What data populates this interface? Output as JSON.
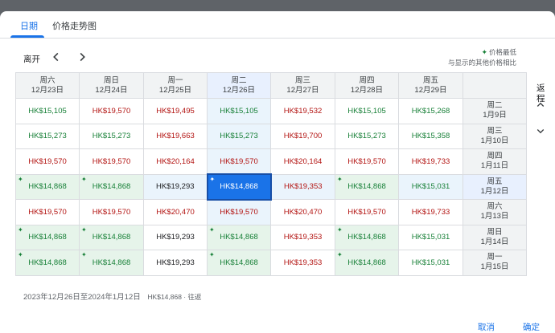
{
  "tabs": [
    {
      "label": "日期",
      "active": true
    },
    {
      "label": "价格走势图",
      "active": false
    }
  ],
  "toolbar": {
    "depart_label": "离开",
    "legend_lowest": "价格最低",
    "legend_note": "与显示的其他价格相比"
  },
  "return_label": "返程",
  "columns": [
    {
      "weekday": "周六",
      "date": "12月23日"
    },
    {
      "weekday": "周日",
      "date": "12月24日"
    },
    {
      "weekday": "周一",
      "date": "12月25日"
    },
    {
      "weekday": "周二",
      "date": "12月26日"
    },
    {
      "weekday": "周三",
      "date": "12月27日"
    },
    {
      "weekday": "周四",
      "date": "12月28日"
    },
    {
      "weekday": "周五",
      "date": "12月29日"
    }
  ],
  "rows": [
    {
      "weekday": "周二",
      "date": "1月9日",
      "cells": [
        {
          "p": "HK$15,105",
          "c": "green"
        },
        {
          "p": "HK$19,570",
          "c": "red"
        },
        {
          "p": "HK$19,495",
          "c": "red"
        },
        {
          "p": "HK$15,105",
          "c": "green"
        },
        {
          "p": "HK$19,532",
          "c": "red"
        },
        {
          "p": "HK$15,105",
          "c": "green"
        },
        {
          "p": "HK$15,268",
          "c": "green"
        }
      ]
    },
    {
      "weekday": "周三",
      "date": "1月10日",
      "cells": [
        {
          "p": "HK$15,273",
          "c": "green"
        },
        {
          "p": "HK$15,273",
          "c": "green"
        },
        {
          "p": "HK$19,663",
          "c": "red"
        },
        {
          "p": "HK$15,273",
          "c": "green"
        },
        {
          "p": "HK$19,700",
          "c": "red"
        },
        {
          "p": "HK$15,273",
          "c": "green"
        },
        {
          "p": "HK$15,358",
          "c": "green"
        }
      ]
    },
    {
      "weekday": "周四",
      "date": "1月11日",
      "cells": [
        {
          "p": "HK$19,570",
          "c": "red"
        },
        {
          "p": "HK$19,570",
          "c": "red"
        },
        {
          "p": "HK$20,164",
          "c": "red"
        },
        {
          "p": "HK$19,570",
          "c": "red"
        },
        {
          "p": "HK$20,164",
          "c": "red"
        },
        {
          "p": "HK$19,570",
          "c": "red"
        },
        {
          "p": "HK$19,733",
          "c": "red"
        }
      ]
    },
    {
      "weekday": "周五",
      "date": "1月12日",
      "cells": [
        {
          "p": "HK$14,868",
          "c": "green",
          "low": true
        },
        {
          "p": "HK$14,868",
          "c": "green",
          "low": true
        },
        {
          "p": "HK$19,293",
          "c": "black"
        },
        {
          "p": "HK$14,868",
          "c": "selected"
        },
        {
          "p": "HK$19,353",
          "c": "red"
        },
        {
          "p": "HK$14,868",
          "c": "green",
          "low": true
        },
        {
          "p": "HK$15,031",
          "c": "green"
        }
      ]
    },
    {
      "weekday": "周六",
      "date": "1月13日",
      "cells": [
        {
          "p": "HK$19,570",
          "c": "red"
        },
        {
          "p": "HK$19,570",
          "c": "red"
        },
        {
          "p": "HK$20,470",
          "c": "red"
        },
        {
          "p": "HK$19,570",
          "c": "red"
        },
        {
          "p": "HK$20,470",
          "c": "red"
        },
        {
          "p": "HK$19,570",
          "c": "red"
        },
        {
          "p": "HK$19,733",
          "c": "red"
        }
      ]
    },
    {
      "weekday": "周日",
      "date": "1月14日",
      "cells": [
        {
          "p": "HK$14,868",
          "c": "green",
          "low": true
        },
        {
          "p": "HK$14,868",
          "c": "green",
          "low": true
        },
        {
          "p": "HK$19,293",
          "c": "black"
        },
        {
          "p": "HK$14,868",
          "c": "green",
          "low": true
        },
        {
          "p": "HK$19,353",
          "c": "red"
        },
        {
          "p": "HK$14,868",
          "c": "green",
          "low": true
        },
        {
          "p": "HK$15,031",
          "c": "green"
        }
      ]
    },
    {
      "weekday": "周一",
      "date": "1月15日",
      "cells": [
        {
          "p": "HK$14,868",
          "c": "green",
          "low": true
        },
        {
          "p": "HK$14,868",
          "c": "green",
          "low": true
        },
        {
          "p": "HK$19,293",
          "c": "black"
        },
        {
          "p": "HK$14,868",
          "c": "green",
          "low": true
        },
        {
          "p": "HK$19,353",
          "c": "red"
        },
        {
          "p": "HK$14,868",
          "c": "green",
          "low": true
        },
        {
          "p": "HK$15,031",
          "c": "green"
        }
      ]
    }
  ],
  "selected_col": 3,
  "selected_row": 3,
  "summary": {
    "dates": "2023年12月26日至2024年1月12日",
    "price": "HK$14,868 · 往返"
  },
  "actions": {
    "cancel": "取消",
    "confirm": "确定"
  },
  "colors": {
    "accent": "#1a73e8",
    "low_price": "#188038",
    "high_price": "#b31412"
  }
}
